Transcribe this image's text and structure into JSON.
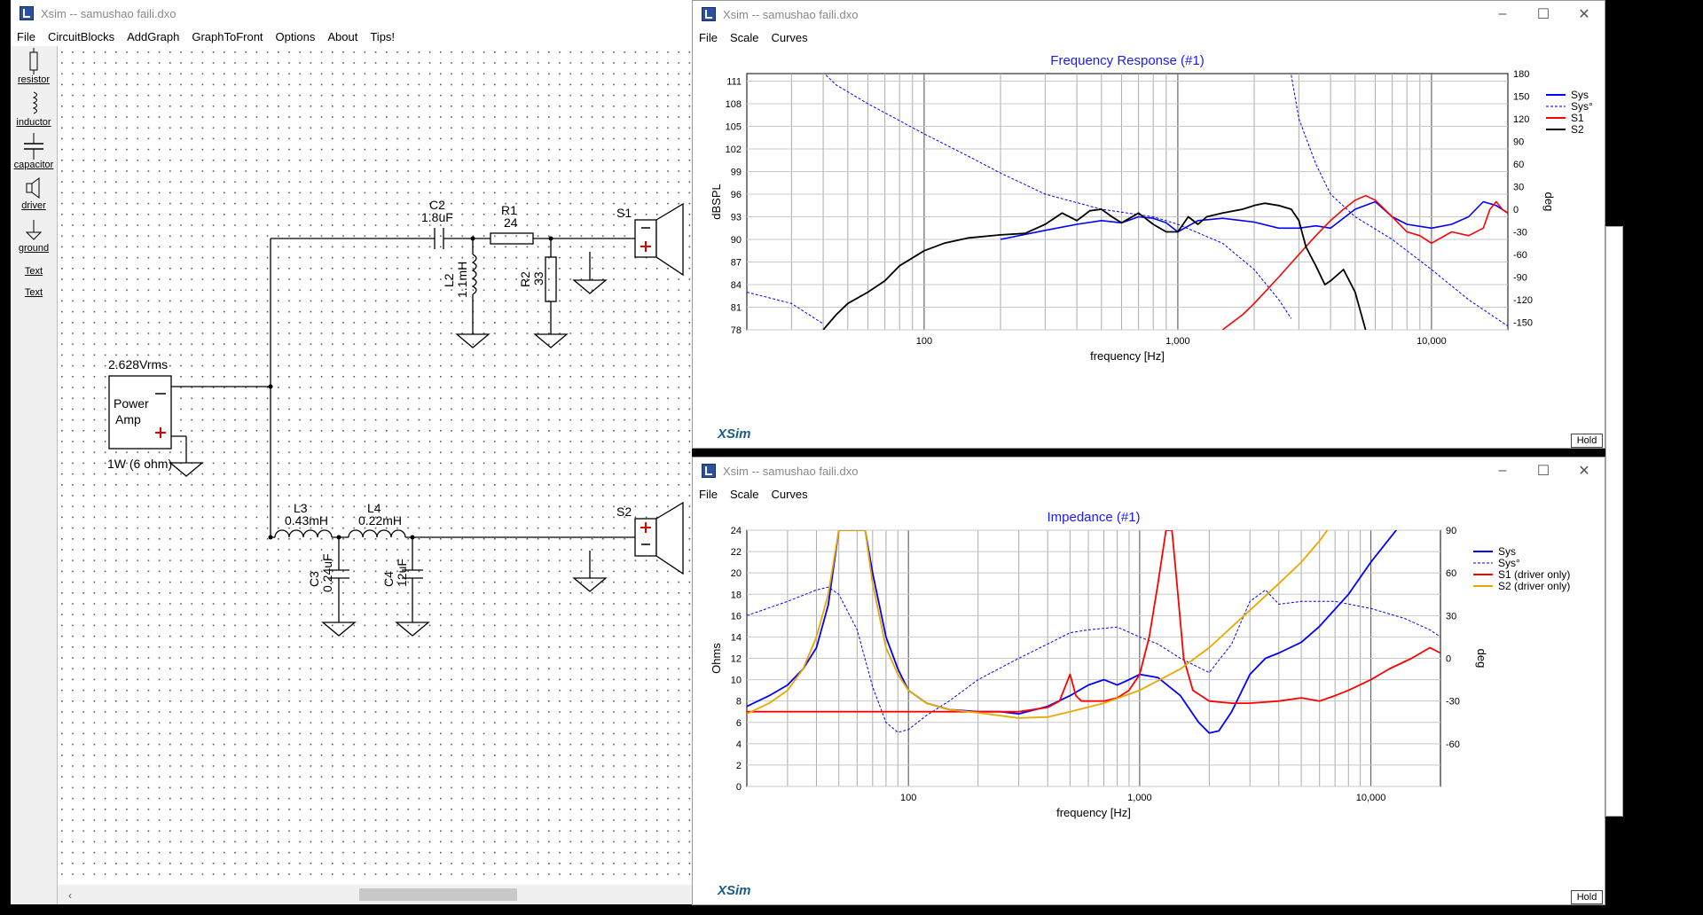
{
  "main_window": {
    "title": "Xsim -- samushao faili.dxo",
    "menu": [
      "File",
      "CircuitBlocks",
      "AddGraph",
      "GraphToFront",
      "Options",
      "About",
      "Tips!"
    ],
    "palette": [
      {
        "label": "resistor",
        "icon": "resistor-icon"
      },
      {
        "label": "inductor",
        "icon": "inductor-icon"
      },
      {
        "label": "capacitor",
        "icon": "capacitor-icon"
      },
      {
        "label": "driver",
        "icon": "driver-icon"
      },
      {
        "label": "ground",
        "icon": "ground-icon"
      },
      {
        "label": "Text",
        "icon": "text-icon"
      },
      {
        "label": "Text",
        "icon": "text-icon"
      }
    ],
    "circuit": {
      "amp_voltage": "2.628Vrms",
      "amp_label_1": "Power",
      "amp_label_2": "Amp",
      "amp_power": "1W (6 ohm)",
      "c2_name": "C2",
      "c2_value": "1.8uF",
      "r1_name": "R1",
      "r1_value": "24",
      "l2_name": "L2",
      "l2_value": "1.1mH",
      "r2_name": "R2",
      "r2_value": "33",
      "s1_name": "S1",
      "l3_name": "L3",
      "l3_value": "0.43mH",
      "l4_name": "L4",
      "l4_value": "0.22mH",
      "c3_name": "C3",
      "c3_value": "0.24uF",
      "c4_name": "C4",
      "c4_value": "12uF",
      "s2_name": "S2"
    }
  },
  "freq_window": {
    "title": "Xsim -- samushao faili.dxo",
    "menu": [
      "File",
      "Scale",
      "Curves"
    ],
    "hold": "Hold",
    "brand": "XSim"
  },
  "imp_window": {
    "title": "Xsim -- samushao faili.dxo",
    "menu": [
      "File",
      "Scale",
      "Curves"
    ],
    "hold": "Hold",
    "brand": "XSim"
  },
  "chart_data": [
    {
      "type": "line",
      "title": "Frequency Response (#1)",
      "xlabel": "frequency [Hz]",
      "ylabel": "dBSPL",
      "y2label": "deg",
      "xscale": "log",
      "xlim": [
        20,
        20000
      ],
      "ylim": [
        78,
        112
      ],
      "y2lim": [
        -160,
        180
      ],
      "yticks": [
        78,
        81,
        84,
        87,
        90,
        93,
        96,
        99,
        102,
        105,
        108,
        111
      ],
      "y2ticks": [
        -150,
        -120,
        -90,
        -60,
        -30,
        0,
        30,
        60,
        90,
        120,
        150,
        180
      ],
      "xtick_labels": [
        {
          "v": 100,
          "t": "100"
        },
        {
          "v": 1000,
          "t": "1,000"
        },
        {
          "v": 10000,
          "t": "10,000"
        }
      ],
      "grid": true,
      "legend": "top-right",
      "series": [
        {
          "name": "Sys",
          "color": "#0000ff",
          "style": "solid",
          "axis": "left",
          "width": 1.6,
          "x": [
            200,
            300,
            400,
            500,
            600,
            700,
            800,
            900,
            1000,
            1200,
            1500,
            2000,
            2500,
            3000,
            3500,
            4000,
            5000,
            6000,
            7000,
            8000,
            10000,
            12000,
            14000,
            16000,
            18000,
            20000
          ],
          "y": [
            90,
            91.2,
            92,
            92.5,
            92.2,
            93,
            92.8,
            92.2,
            91,
            92.5,
            92.8,
            92.3,
            91.5,
            91.5,
            91.8,
            91.5,
            94,
            95,
            93,
            92,
            91.5,
            92,
            93,
            95,
            94.5,
            93.5
          ]
        },
        {
          "name": "Sys°",
          "color": "#0000ff",
          "style": "dashed",
          "axis": "right",
          "width": 1,
          "x": [
            20,
            30,
            40,
            41,
            45,
            60,
            100,
            150,
            200,
            300,
            500,
            800,
            1000,
            1500,
            2000,
            2500,
            2800,
            2801,
            3000,
            3500,
            4000,
            5000,
            7000,
            10000,
            14000,
            20000
          ],
          "y": [
            -110,
            -125,
            -152,
            178,
            165,
            140,
            100,
            70,
            48,
            20,
            0,
            -10,
            -20,
            -45,
            -80,
            -120,
            -145,
            178,
            120,
            60,
            20,
            -10,
            -40,
            -80,
            -120,
            -155
          ]
        },
        {
          "name": "S1",
          "color": "#ff0000",
          "style": "solid",
          "axis": "left",
          "width": 1.6,
          "x": [
            1500,
            1800,
            2000,
            2500,
            3000,
            3500,
            4000,
            4500,
            5000,
            5500,
            6000,
            7000,
            8000,
            9000,
            10000,
            12000,
            14000,
            16000,
            17000,
            18000,
            19000,
            20000
          ],
          "y": [
            78,
            80,
            81.5,
            85,
            88,
            90.5,
            92.5,
            94,
            95.2,
            95.8,
            95.2,
            93,
            91,
            90.5,
            89.5,
            91,
            90.5,
            91.5,
            94,
            95,
            94,
            93.5
          ]
        },
        {
          "name": "S2",
          "color": "#000000",
          "style": "solid",
          "axis": "left",
          "width": 1.8,
          "x": [
            40,
            45,
            50,
            60,
            70,
            80,
            100,
            120,
            150,
            200,
            250,
            300,
            350,
            400,
            450,
            500,
            550,
            600,
            700,
            800,
            900,
            1000,
            1100,
            1200,
            1300,
            1500,
            1800,
            2000,
            2200,
            2500,
            2800,
            3000,
            3200,
            3500,
            3800,
            4000,
            4500,
            5000,
            5500
          ],
          "y": [
            78,
            80,
            81.5,
            83,
            84.5,
            86.5,
            88.5,
            89.5,
            90.2,
            90.6,
            90.8,
            92,
            93.5,
            92.5,
            93.8,
            94,
            93,
            92.2,
            93.5,
            92,
            91,
            91,
            93,
            92,
            93,
            93.5,
            94,
            94.5,
            94.8,
            94.5,
            94,
            92.5,
            89,
            86.5,
            84,
            84.5,
            86,
            83,
            78
          ]
        }
      ]
    },
    {
      "type": "line",
      "title": "Impedance (#1)",
      "xlabel": "frequency [Hz]",
      "ylabel": "Ohms",
      "y2label": "deg",
      "xscale": "log",
      "xlim": [
        20,
        20000
      ],
      "ylim": [
        0,
        24
      ],
      "y2lim": [
        -90,
        90
      ],
      "yticks": [
        0,
        2,
        4,
        6,
        8,
        10,
        12,
        14,
        16,
        18,
        20,
        22,
        24
      ],
      "y2ticks": [
        -60,
        -30,
        0,
        30,
        60,
        90
      ],
      "xtick_labels": [
        {
          "v": 100,
          "t": "100"
        },
        {
          "v": 1000,
          "t": "1,000"
        },
        {
          "v": 10000,
          "t": "10,000"
        }
      ],
      "grid": true,
      "legend": "top-right",
      "series": [
        {
          "name": "Sys",
          "color": "#0000ff",
          "style": "solid",
          "axis": "left",
          "width": 1.8,
          "x": [
            20,
            25,
            30,
            35,
            40,
            45,
            50,
            55,
            60,
            65,
            70,
            80,
            90,
            100,
            120,
            150,
            200,
            250,
            300,
            400,
            500,
            600,
            700,
            800,
            900,
            1000,
            1200,
            1500,
            1800,
            2000,
            2200,
            2500,
            3000,
            3500,
            4000,
            5000,
            6000,
            8000,
            10000,
            14000,
            18000,
            20000
          ],
          "y": [
            7.5,
            8.5,
            9.5,
            11,
            13,
            17,
            24,
            24,
            24,
            24,
            20,
            14,
            11,
            9,
            7.8,
            7.2,
            7,
            7,
            6.8,
            7.5,
            8.5,
            9.5,
            10,
            9.5,
            10,
            10.5,
            10.2,
            8.5,
            6,
            5,
            5.2,
            7,
            10.5,
            12,
            12.5,
            13.5,
            15,
            18,
            21,
            25,
            25,
            25
          ]
        },
        {
          "name": "Sys°",
          "color": "#0000ff",
          "style": "dashed",
          "axis": "right",
          "width": 1,
          "x": [
            20,
            30,
            40,
            45,
            50,
            60,
            70,
            80,
            90,
            100,
            120,
            150,
            200,
            300,
            400,
            500,
            600,
            800,
            1000,
            1200,
            1500,
            2000,
            2500,
            3000,
            3500,
            4000,
            5000,
            7000,
            10000,
            14000,
            18000,
            20000
          ],
          "y": [
            30,
            40,
            48,
            50,
            45,
            20,
            -20,
            -45,
            -52,
            -50,
            -40,
            -30,
            -15,
            0,
            10,
            18,
            20,
            22,
            15,
            10,
            0,
            -10,
            10,
            40,
            48,
            38,
            40,
            40,
            35,
            28,
            20,
            15
          ]
        },
        {
          "name": "S1 (driver only)",
          "color": "#ff0000",
          "style": "solid",
          "axis": "left",
          "width": 1.8,
          "x": [
            20,
            100,
            200,
            300,
            400,
            450,
            500,
            530,
            560,
            600,
            700,
            800,
            900,
            1000,
            1100,
            1200,
            1300,
            1380,
            1450,
            1550,
            1700,
            2000,
            2500,
            3000,
            4000,
            5000,
            6000,
            7000,
            8000,
            10000,
            12000,
            15000,
            18000,
            20000
          ],
          "y": [
            7,
            7,
            7,
            7,
            7.4,
            8,
            10.5,
            8.5,
            8,
            8,
            8,
            8.3,
            9,
            10.5,
            14,
            19,
            24,
            24,
            19,
            12,
            9,
            8,
            7.8,
            7.8,
            8,
            8.3,
            8,
            8.5,
            9,
            10,
            11,
            12,
            13,
            12.5
          ]
        },
        {
          "name": "S2 (driver only)",
          "color": "#e8a800",
          "style": "solid",
          "axis": "left",
          "width": 1.8,
          "x": [
            20,
            25,
            30,
            35,
            40,
            45,
            50,
            55,
            60,
            65,
            70,
            80,
            90,
            100,
            120,
            150,
            200,
            300,
            400,
            500,
            700,
            1000,
            1500,
            2000,
            3000,
            4000,
            5000,
            6000,
            7000
          ],
          "y": [
            6.8,
            7.8,
            9,
            11,
            14,
            18,
            24,
            24,
            24,
            24,
            19,
            13,
            10.5,
            9,
            7.8,
            7.2,
            6.9,
            6.4,
            6.5,
            7,
            7.8,
            9,
            11,
            13,
            16.5,
            19,
            21,
            23,
            25
          ]
        }
      ]
    }
  ]
}
